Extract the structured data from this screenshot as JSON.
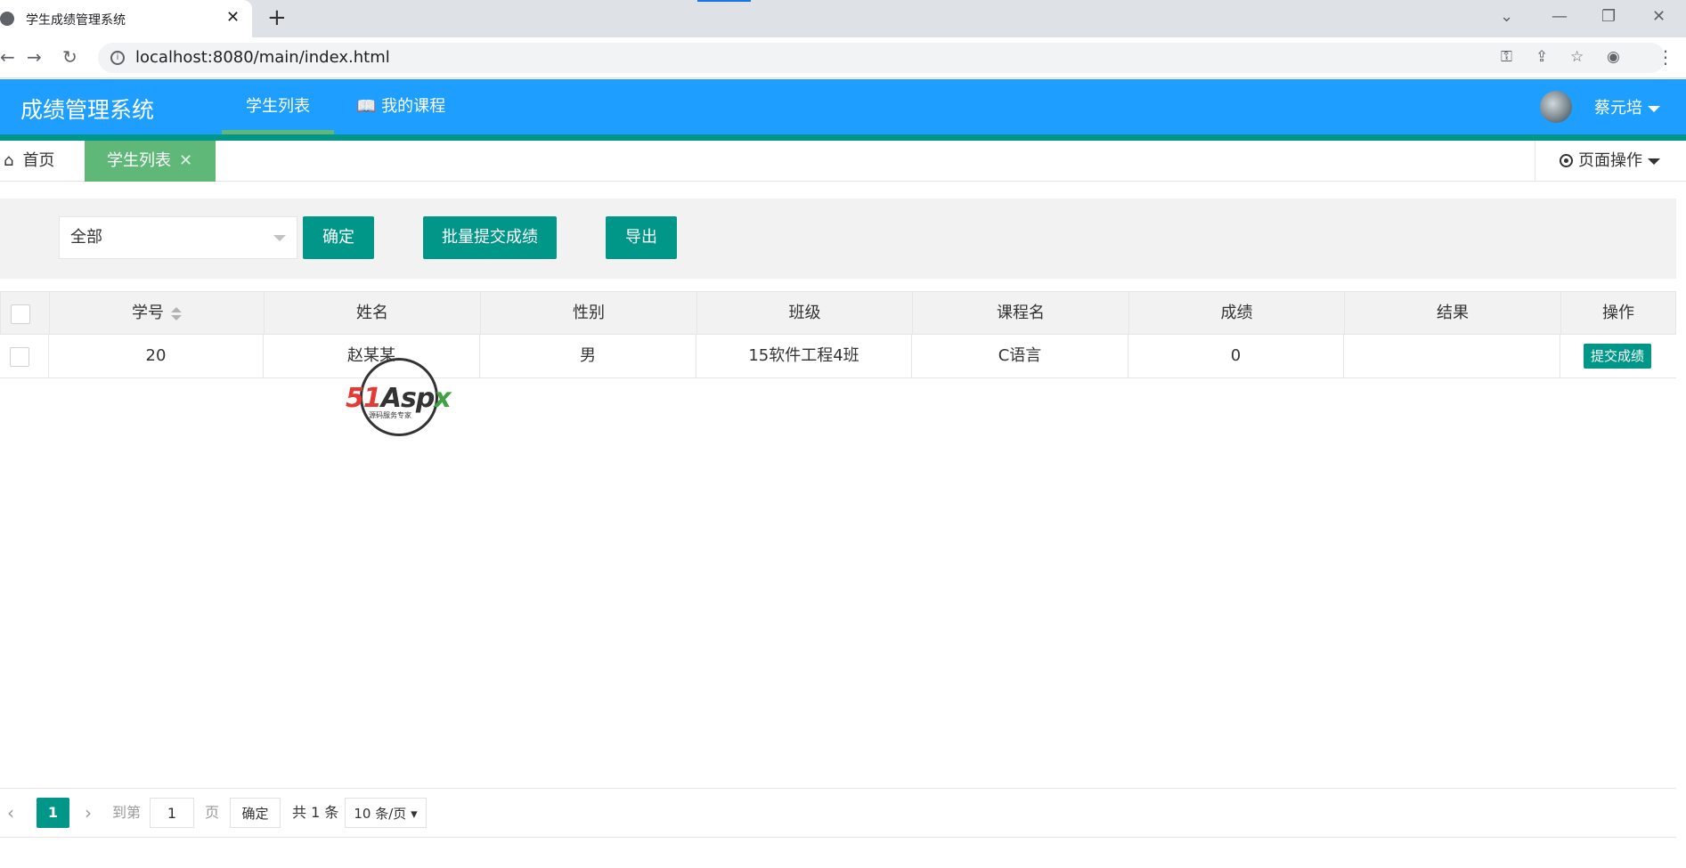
{
  "browser": {
    "tab_title": "学生成绩管理系统",
    "url": "localhost:8080/main/index.html"
  },
  "header": {
    "brand": "成绩管理系统",
    "nav": [
      {
        "label": "学生列表",
        "active": true
      },
      {
        "label": "我的课程",
        "icon": "book-icon"
      }
    ],
    "user": "蔡元培"
  },
  "tabs": {
    "home": "首页",
    "current": "学生列表",
    "page_ops": "页面操作"
  },
  "toolbar": {
    "select_value": "全部",
    "confirm": "确定",
    "batch_submit": "批量提交成绩",
    "export": "导出"
  },
  "table": {
    "columns": [
      "学号",
      "姓名",
      "性别",
      "班级",
      "课程名",
      "成绩",
      "结果",
      "操作"
    ],
    "rows": [
      {
        "id": "20",
        "name": "赵某某",
        "gender": "男",
        "class": "15软件工程4班",
        "course": "C语言",
        "score": "0",
        "result": "",
        "action": "提交成绩"
      }
    ]
  },
  "watermark": {
    "brand_a": "51",
    "brand_b": "Asp",
    "brand_c": "x",
    "slogan": "源码服务专家"
  },
  "pager": {
    "current_page": "1",
    "goto_label": "到第",
    "goto_value": "1",
    "page_unit": "页",
    "confirm": "确定",
    "total": "共 1 条",
    "page_size": "10 条/页"
  },
  "colors": {
    "header_blue": "#1e9fff",
    "teal": "#009688",
    "green": "#5fb878"
  }
}
